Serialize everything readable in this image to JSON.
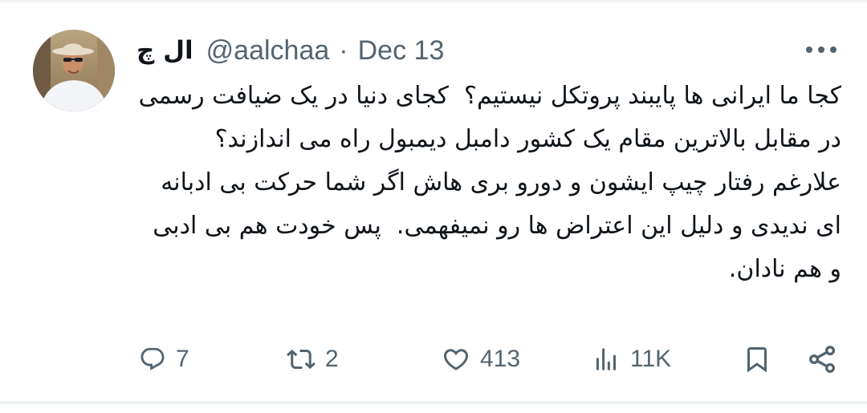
{
  "user": {
    "display_name": "ال چ",
    "handle": "@aalchaa",
    "separator": "·",
    "date": "Dec 13"
  },
  "more_icon": "more-horizontal-icon",
  "body": {
    "paragraph_1": "کجا ما ایرانی ها پایبند پروتکل نیستیم؟  کجای دنیا در یک ضیافت رسمی در مقابل بالاترین مقام یک کشور دامبل دیمبول راه می اندازند؟",
    "paragraph_2": "علارغم رفتار چیپ ایشون و دورو بری هاش اگر شما حرکت بی ادبانه ای ندیدی و دلیل این اعتراض ها رو نمیفهمی.  پس خودت هم بی ادبی و هم نادان."
  },
  "actions": {
    "replies": "7",
    "retweets": "2",
    "likes": "413",
    "views": "11K"
  },
  "icons": [
    "reply-icon",
    "retweet-icon",
    "heart-icon",
    "views-icon",
    "bookmark-icon",
    "share-icon"
  ],
  "colors": {
    "text": "#0f1419",
    "secondary": "#536471",
    "divider": "#eff3f4"
  }
}
